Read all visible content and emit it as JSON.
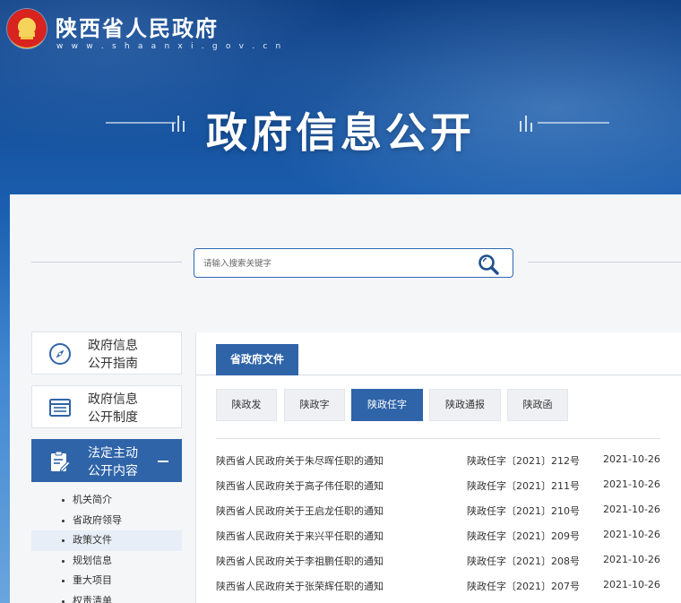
{
  "header": {
    "site_title": "陕西省人民政府",
    "site_url": "w w w . s h a a n x i . g o v . c n",
    "hero_title": "政府信息公开"
  },
  "search": {
    "placeholder": "请输入搜索关键字",
    "value": ""
  },
  "sidebar": {
    "cards": [
      {
        "label": "政府信息\n公开指南",
        "icon": "compass-icon"
      },
      {
        "label": "政府信息\n公开制度",
        "icon": "list-document-icon"
      },
      {
        "label": "法定主动\n公开内容",
        "icon": "clipboard-edit-icon"
      }
    ],
    "sub_items": [
      {
        "label": "机关简介"
      },
      {
        "label": "省政府领导"
      },
      {
        "label": "政策文件"
      },
      {
        "label": "规划信息"
      },
      {
        "label": "重大项目"
      },
      {
        "label": "权责清单"
      }
    ]
  },
  "content": {
    "section_tab": "省政府文件",
    "subtabs": [
      {
        "label": "陕政发"
      },
      {
        "label": "陕政字"
      },
      {
        "label": "陕政任字"
      },
      {
        "label": "陕政通报"
      },
      {
        "label": "陕政函"
      }
    ],
    "rows": [
      {
        "title": "陕西省人民政府关于朱尽晖任职的通知",
        "doc_no": "陕政任字〔2021〕212号",
        "date": "2021-10-26"
      },
      {
        "title": "陕西省人民政府关于高子伟任职的通知",
        "doc_no": "陕政任字〔2021〕211号",
        "date": "2021-10-26"
      },
      {
        "title": "陕西省人民政府关于王启龙任职的通知",
        "doc_no": "陕政任字〔2021〕210号",
        "date": "2021-10-26"
      },
      {
        "title": "陕西省人民政府关于来兴平任职的通知",
        "doc_no": "陕政任字〔2021〕209号",
        "date": "2021-10-26"
      },
      {
        "title": "陕西省人民政府关于李祖鹏任职的通知",
        "doc_no": "陕政任字〔2021〕208号",
        "date": "2021-10-26"
      },
      {
        "title": "陕西省人民政府关于张荣辉任职的通知",
        "doc_no": "陕政任字〔2021〕207号",
        "date": "2021-10-26"
      }
    ]
  },
  "colors": {
    "primary_blue": "#2f64a8",
    "banner_top": "#0f3f83",
    "panel_bg": "#f5f6f8"
  }
}
